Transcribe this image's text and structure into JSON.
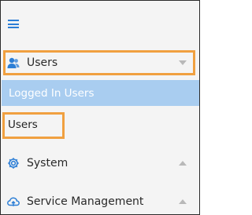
{
  "sidebar": {
    "menu_icon": "hamburger-icon",
    "users_group": {
      "label": "Users",
      "icon": "users-icon",
      "expanded": true,
      "children": [
        {
          "label": "Logged In Users",
          "active": true
        },
        {
          "label": "Users",
          "active": false
        }
      ]
    },
    "system": {
      "label": "System",
      "icon": "gear-icon"
    },
    "service_management": {
      "label": "Service Management",
      "icon": "cloud-icon"
    }
  },
  "colors": {
    "accent": "#2c7ed6",
    "active_bg": "#a9cdf0",
    "highlight": "#f0a040"
  }
}
